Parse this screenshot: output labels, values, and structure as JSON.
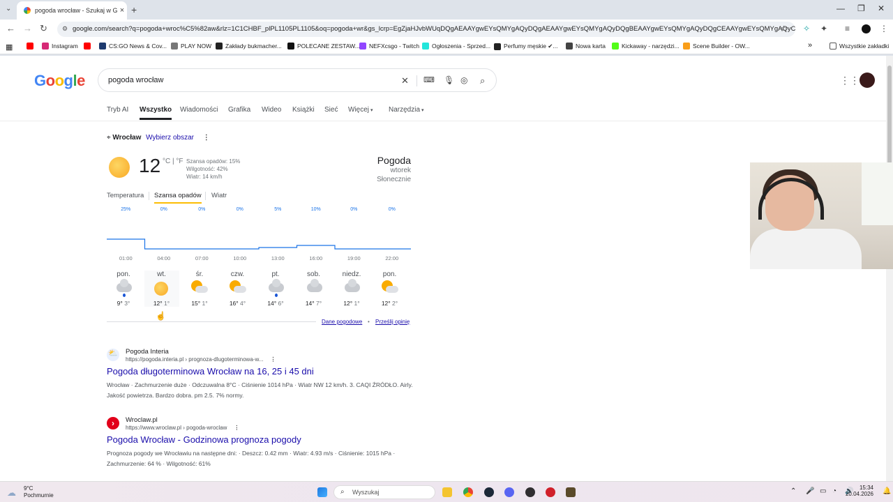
{
  "browser": {
    "tab_title": "pogoda wrocław - Szukaj w Go",
    "tab_close": "×",
    "new_tab": "+",
    "url": "google.com/search?q=pogoda+wroc%C5%82aw&rlz=1C1CHBF_plPL1105PL1105&oq=pogoda+wr&gs_lcrp=EgZjaHJvbWUqDQgAEAAYgwEYsQMYgAQyDQgAEAAYgwEYsQMYgAQyDQgBEAAYgwEYsQMYgAQyDQgCEAAYgwEYsQMYgAQyCggDEAAYsQMYgAQ",
    "bookmarks": [
      {
        "label": "",
        "color": "#ff0000"
      },
      {
        "label": "Instagram",
        "color": "#d62976"
      },
      {
        "label": "",
        "color": "#ff0000"
      },
      {
        "label": "CS:GO News & Cov...",
        "color": "#1d3a6e"
      },
      {
        "label": "PLAY NOW",
        "color": "#777777"
      },
      {
        "label": "Zakłady bukmacher...",
        "color": "#222222"
      },
      {
        "label": "POLECANE ZESTAW...",
        "color": "#111111"
      },
      {
        "label": "NEFXcsgo - Twitch",
        "color": "#9146ff"
      },
      {
        "label": "Ogłoszenia - Sprzed...",
        "color": "#23e5db"
      },
      {
        "label": "Perfumy męskie ✔...",
        "color": "#222222"
      },
      {
        "label": "Nowa karta",
        "color": "#444444"
      },
      {
        "label": "Kickaway - narzędzi...",
        "color": "#53fc18"
      },
      {
        "label": "Scene Builder - OW...",
        "color": "#f99e1a"
      }
    ],
    "bookmarks_more": "»",
    "all_bookmarks": "Wszystkie zakładki"
  },
  "google": {
    "logo": "Google",
    "query": "pogoda wrocław",
    "nav_tabs": [
      "Tryb AI",
      "Wszystko",
      "Wiadomości",
      "Grafika",
      "Wideo",
      "Książki",
      "Sieć",
      "Więcej",
      "Narzędzia"
    ]
  },
  "weather": {
    "location": "Wrocław",
    "pick_area": "Wybierz obszar",
    "temp": "12",
    "units": "°C | °F",
    "rain_chance": "Szansa opadów: 15%",
    "humidity": "Wilgotność: 42%",
    "wind": "Wiatr: 14 km/h",
    "title": "Pogoda",
    "day": "wtorek",
    "condition": "Słonecznie",
    "tabs": [
      "Temperatura",
      "Szansa opadów",
      "Wiatr"
    ],
    "hours": [
      "01:00",
      "04:00",
      "07:00",
      "10:00",
      "13:00",
      "16:00",
      "19:00",
      "22:00"
    ],
    "precip_labels": [
      "25%",
      "0%",
      "0%",
      "0%",
      "5%",
      "10%",
      "0%",
      "0%"
    ],
    "precip_values": [
      25,
      0,
      0,
      0,
      5,
      10,
      0,
      0
    ],
    "days": [
      {
        "name": "pon.",
        "hi": "9°",
        "lo": "3°",
        "icon": "rain-icon"
      },
      {
        "name": "wt.",
        "hi": "12°",
        "lo": "1°",
        "icon": "sun-icon"
      },
      {
        "name": "śr.",
        "hi": "15°",
        "lo": "1°",
        "icon": "partly-cloudy-icon"
      },
      {
        "name": "czw.",
        "hi": "16°",
        "lo": "4°",
        "icon": "partly-cloudy-icon"
      },
      {
        "name": "pt.",
        "hi": "14°",
        "lo": "6°",
        "icon": "rain-icon"
      },
      {
        "name": "sob.",
        "hi": "14°",
        "lo": "7°",
        "icon": "cloud-icon"
      },
      {
        "name": "niedz.",
        "hi": "12°",
        "lo": "1°",
        "icon": "cloud-icon"
      },
      {
        "name": "pon.",
        "hi": "12°",
        "lo": "2°",
        "icon": "partly-cloudy-icon"
      }
    ],
    "data_link": "Dane pogodowe",
    "feedback_link": "Prześlij opinię"
  },
  "results": [
    {
      "site": "Pogoda Interia",
      "url": "https://pogoda.interia.pl › prognoza-dlugoterminowa-w...",
      "title": "Pogoda długoterminowa Wrocław na 16, 25 i 45 dni",
      "snippet": "Wrocław · Zachmurzenie duże · Odczuwalna 8°C · Ciśnienie 1014 hPa · Wiatr NW 12 km/h. 3. CAQI ŹRÓDŁO. Airly. Jakość powietrza. Bardzo dobra. pm 2.5. 7% normy."
    },
    {
      "site": "Wroclaw.pl",
      "url": "https://www.wroclaw.pl › pogoda-wroclaw",
      "title": "Pogoda Wrocław - Godzinowa prognoza pogody",
      "snippet": "Prognoza pogody we Wrocławiu na następne dni: · Deszcz: 0.42 mm · Wiatr: 4.93 m/s · Ciśnienie: 1015 hPa · Zachmurzenie: 64 % · Wilgotność: 61%"
    }
  ],
  "taskbar": {
    "weather_temp": "9°C",
    "weather_desc": "Pochmurnie",
    "search": "Wyszukaj",
    "time": "15:34",
    "date": "20.04.2026"
  }
}
